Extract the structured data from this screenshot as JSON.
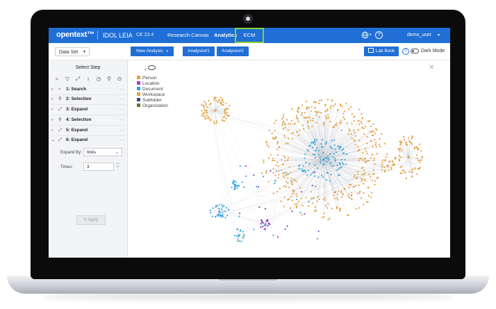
{
  "topbar": {
    "brand": "opentext™",
    "product": "IDOL LEIA",
    "version": "CE 23.4",
    "tabs": [
      {
        "label": "Research Canvas"
      },
      {
        "label": "Analytics"
      },
      {
        "label": "ECM"
      }
    ],
    "user": "demo_user",
    "icons": [
      "globe-icon",
      "help-icon",
      "chevron-down-icon"
    ]
  },
  "toolbar": {
    "dataset_select": "Data Set",
    "new_analysis": "New Analysis",
    "analysis_tabs": [
      "Analysis#1",
      "Analysis#2"
    ],
    "lab_book": "Lab Book",
    "dark_mode": "Dark Mode"
  },
  "sidebar": {
    "title": "Select Step",
    "tool_icons": [
      "search-icon",
      "filter-icon",
      "expand-icon",
      "bulb-icon",
      "timer-icon",
      "attach-icon",
      "location-icon"
    ],
    "steps": [
      {
        "label": "1: Search",
        "icon": "search-icon"
      },
      {
        "label": "2: Selection",
        "icon": "attach-icon"
      },
      {
        "label": "3: Expand",
        "icon": "expand-icon"
      },
      {
        "label": "4: Selection",
        "icon": "attach-icon"
      },
      {
        "label": "5: Expand",
        "icon": "expand-icon"
      },
      {
        "label": "6: Expand",
        "icon": "expand-icon"
      }
    ],
    "expand_by_label": "Expand By:",
    "expand_by_value": "links",
    "times_label": "Times:",
    "times_value": "3",
    "apply_label": "Apply"
  },
  "graph": {
    "legend": [
      {
        "label": "Person",
        "color": "#e0a046"
      },
      {
        "label": "Location",
        "color": "#9b3fc4"
      },
      {
        "label": "Document",
        "color": "#2ea4dc"
      },
      {
        "label": "Workspace",
        "color": "#e6a23c"
      },
      {
        "label": "Subfolder",
        "color": "#3a4a8c"
      },
      {
        "label": "Organization",
        "color": "#5a7a2a"
      }
    ]
  },
  "colors": {
    "brand_blue": "#1f6fd6",
    "highlight_green": "#8ad03a",
    "node_orange": "#e2a03f",
    "node_blue": "#3aa8e0",
    "node_purple": "#8e3bbf",
    "edge_gray": "#c9ccd1"
  }
}
